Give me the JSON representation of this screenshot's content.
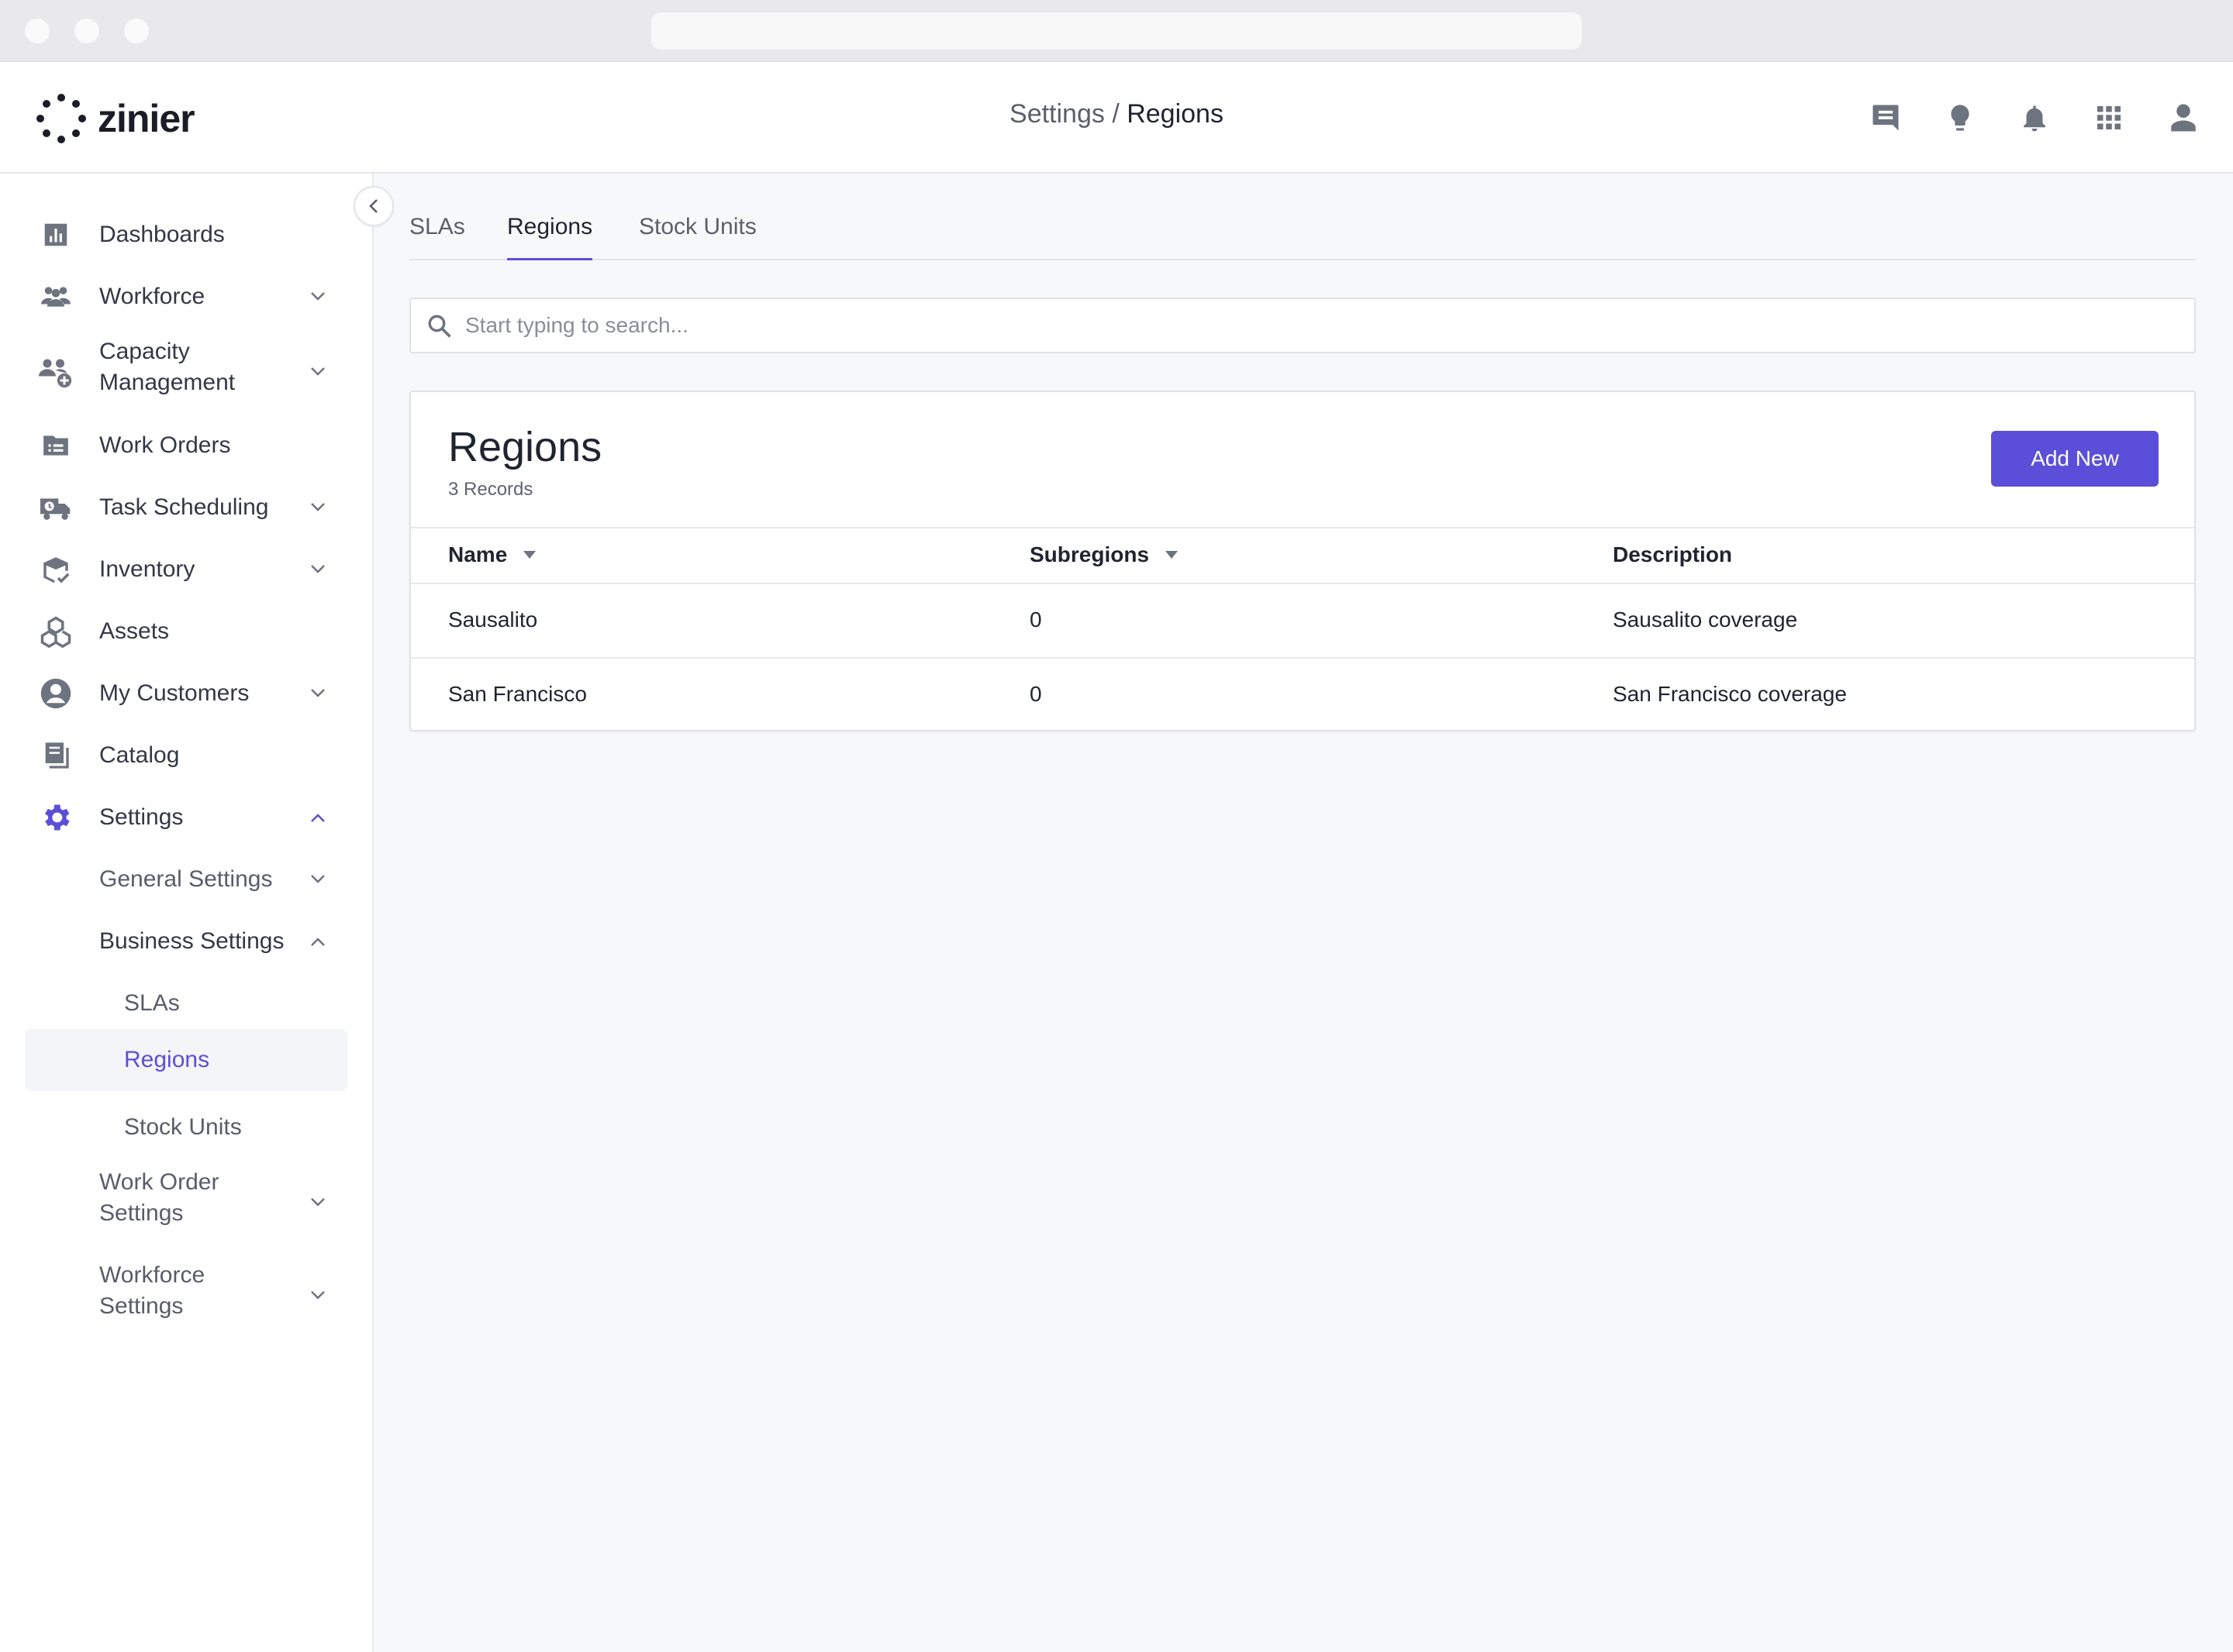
{
  "header": {
    "logo_text": "zinier",
    "breadcrumb_parent": "Settings",
    "breadcrumb_separator": " / ",
    "breadcrumb_current": "Regions",
    "icons": [
      "chat-icon",
      "lightbulb-icon",
      "bell-icon",
      "apps-grid-icon",
      "user-icon"
    ]
  },
  "sidebar": {
    "items": [
      {
        "label": "Dashboards",
        "icon": "bar-chart-icon"
      },
      {
        "label": "Workforce",
        "icon": "people-icon"
      },
      {
        "label": "Capacity",
        "label2": "Management",
        "icon": "capacity-icon"
      },
      {
        "label": "Work Orders",
        "icon": "folder-list-icon"
      },
      {
        "label": "Task Scheduling",
        "icon": "truck-clock-icon"
      },
      {
        "label": "Inventory",
        "icon": "box-check-icon"
      },
      {
        "label": "Assets",
        "icon": "cubes-icon"
      },
      {
        "label": "My Customers",
        "icon": "account-circle-icon"
      },
      {
        "label": "Catalog",
        "icon": "book-icon"
      },
      {
        "label": "Settings",
        "icon": "gear-icon"
      }
    ],
    "settings_children": {
      "general": "General Settings",
      "business": "Business Settings",
      "business_children": [
        "SLAs",
        "Regions",
        "Stock Units"
      ],
      "work_order_1": "Work Order",
      "work_order_2": "Settings",
      "workforce_1": "Workforce",
      "workforce_2": "Settings"
    }
  },
  "tabs": [
    "SLAs",
    "Regions",
    "Stock Units"
  ],
  "active_tab": "Regions",
  "search": {
    "placeholder": "Start typing to search..."
  },
  "card": {
    "title": "Regions",
    "count": "3 Records",
    "add_label": "Add New",
    "columns": [
      "Name",
      "Subregions",
      "Description"
    ],
    "rows": [
      {
        "name": "Sausalito",
        "subregions": "0",
        "description": "Sausalito coverage"
      },
      {
        "name": "San Francisco",
        "subregions": "0",
        "description": "San Francisco coverage"
      }
    ]
  },
  "colors": {
    "accent": "#5b4fd9",
    "icon_gray": "#6e7380"
  }
}
